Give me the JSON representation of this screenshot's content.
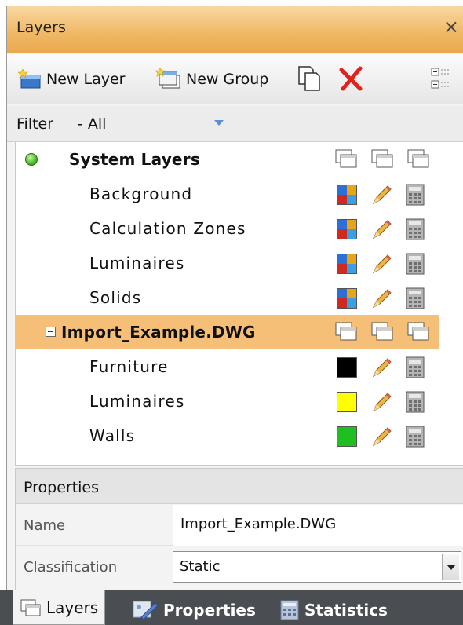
{
  "window": {
    "title": "Layers",
    "close_glyph": "×"
  },
  "toolbar": {
    "new_layer_label": "New Layer",
    "new_group_label": "New Group",
    "icons": [
      "new-layer-icon",
      "new-group-icon",
      "copy-icon",
      "delete-icon",
      "options-icon"
    ]
  },
  "filter": {
    "label": "Filter",
    "value": "- All"
  },
  "tree": {
    "groups": [
      {
        "name": "System Layers",
        "status": "active",
        "layers": [
          {
            "name": "Background",
            "color": "multi"
          },
          {
            "name": "Calculation Zones",
            "color": "multi"
          },
          {
            "name": "Luminaires",
            "color": "multi"
          },
          {
            "name": "Solids",
            "color": "multi"
          }
        ]
      },
      {
        "name": "Import_Example.DWG",
        "selected": true,
        "expanded": true,
        "layers": [
          {
            "name": "Furniture",
            "color": "#000000"
          },
          {
            "name": "Luminaires",
            "color": "#ffff00"
          },
          {
            "name": "Walls",
            "color": "#1fbf1f"
          }
        ]
      }
    ]
  },
  "properties": {
    "header": "Properties",
    "name_label": "Name",
    "name_value": "Import_Example.DWG",
    "classification_label": "Classification",
    "classification_value": "Static"
  },
  "tabs": [
    {
      "label": "Layers",
      "active": true
    },
    {
      "label": "Properties",
      "active": false
    },
    {
      "label": "Statistics",
      "active": false
    }
  ],
  "colors": {
    "title_bar": "#f0b764",
    "selection": "#f6bf78",
    "tab_strip": "#4a4d52"
  }
}
